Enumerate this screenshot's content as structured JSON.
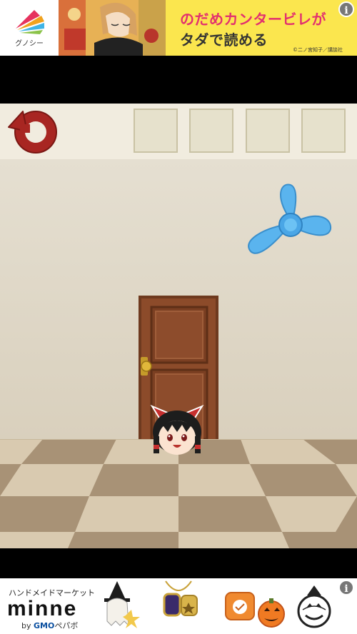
{
  "top_ad": {
    "brand_label": "グノシー",
    "line1": "のだめカンタービレが",
    "line2": "タダで読める",
    "credit": "©二ノ宮知子／講談社",
    "info_icon": "i"
  },
  "toolbar": {
    "reset_icon": "refresh-arrow-icon",
    "slots": [
      "",
      "",
      "",
      ""
    ]
  },
  "room": {
    "objects": [
      "door",
      "blue-fan",
      "yukkuri-reimu"
    ]
  },
  "bottom_ad": {
    "subtitle": "ハンドメイドマーケット",
    "logo": "minne",
    "by_prefix": "by ",
    "by_brand": "GMO",
    "by_suffix": "ペパボ",
    "info_icon": "i"
  },
  "colors": {
    "wall": "#e3dccd",
    "door": "#8b4a2a",
    "fan": "#5ab4ee",
    "reset": "#a82622",
    "ad_pink": "#e2306f",
    "ad_yellow": "#fbe64e"
  }
}
